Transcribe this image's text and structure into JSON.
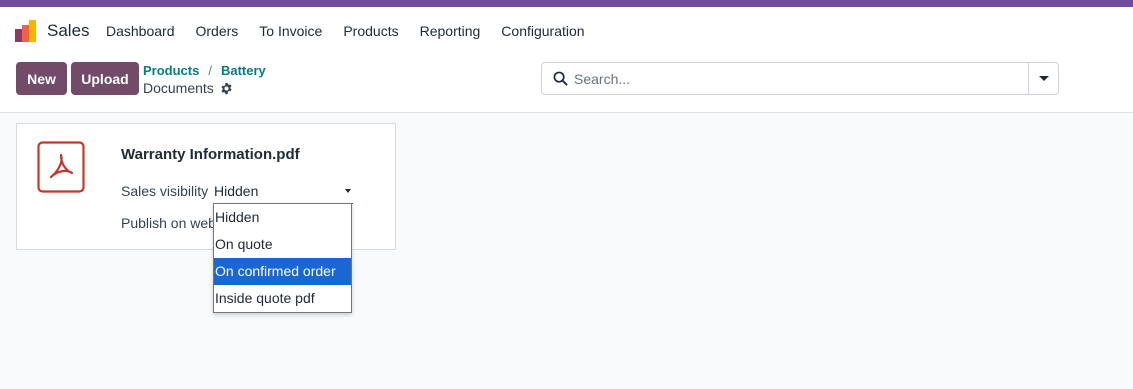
{
  "colors": {
    "brand": "#714b9e",
    "primary": "#714b67",
    "link": "#017e84",
    "highlight": "#1967d2"
  },
  "app": {
    "name": "Sales",
    "logo_icon": "sales-logo-icon"
  },
  "menu": [
    {
      "label": "Dashboard"
    },
    {
      "label": "Orders"
    },
    {
      "label": "To Invoice"
    },
    {
      "label": "Products"
    },
    {
      "label": "Reporting"
    },
    {
      "label": "Configuration"
    }
  ],
  "actions": {
    "new_label": "New",
    "upload_label": "Upload"
  },
  "breadcrumb": {
    "items": [
      "Products",
      "Battery"
    ],
    "separator": "/",
    "current": "Documents",
    "settings_icon": "gear-icon"
  },
  "search": {
    "placeholder": "Search...",
    "value": ""
  },
  "document": {
    "file_icon": "pdf-icon",
    "name": "Warranty Information.pdf",
    "sales_visibility_label": "Sales visibility",
    "sales_visibility_value": "Hidden",
    "publish_label": "Publish on website"
  },
  "dropdown": {
    "options": [
      "Hidden",
      "On quote",
      "On confirmed order",
      "Inside quote pdf"
    ],
    "highlighted": "On confirmed order"
  }
}
